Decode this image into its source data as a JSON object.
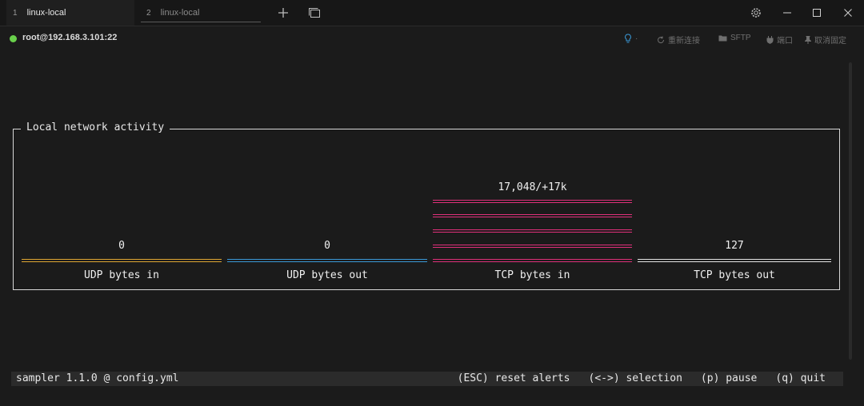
{
  "tabs": [
    {
      "num": "1",
      "label": "linux-local"
    },
    {
      "num": "2",
      "label": "linux-local"
    }
  ],
  "titlebar_icons": [
    "plus-icon",
    "window-icon",
    "gear-icon",
    "minimize-icon",
    "maximize-icon",
    "close-icon"
  ],
  "session": {
    "host": "root@192.168.3.101:22",
    "status_color": "#69d04b",
    "actions": [
      {
        "icon": "bulb-icon",
        "label": "·"
      },
      {
        "icon": "refresh-icon",
        "label": "重新连接"
      },
      {
        "icon": "folder-icon",
        "label": "SFTP"
      },
      {
        "icon": "plug-icon",
        "label": "端口"
      },
      {
        "icon": "pin-icon",
        "label": "取消固定"
      }
    ]
  },
  "panel": {
    "title": "Local network activity",
    "gauges": [
      {
        "label": "UDP bytes in",
        "value": "0",
        "color": "#e0a733",
        "lines": 1
      },
      {
        "label": "UDP bytes out",
        "value": "0",
        "color": "#3a9ad9",
        "lines": 1
      },
      {
        "label": "TCP bytes in",
        "value": "17,048/+17k",
        "color": "#e0307a",
        "lines": 5
      },
      {
        "label": "TCP bytes out",
        "value": "127",
        "color": "#e6e6e6",
        "lines": 1
      }
    ]
  },
  "status": {
    "app": "sampler 1.1.0 @ config.yml",
    "keys": [
      "(ESC) reset alerts",
      "(<->) selection",
      "(p) pause",
      "(q) quit"
    ]
  }
}
